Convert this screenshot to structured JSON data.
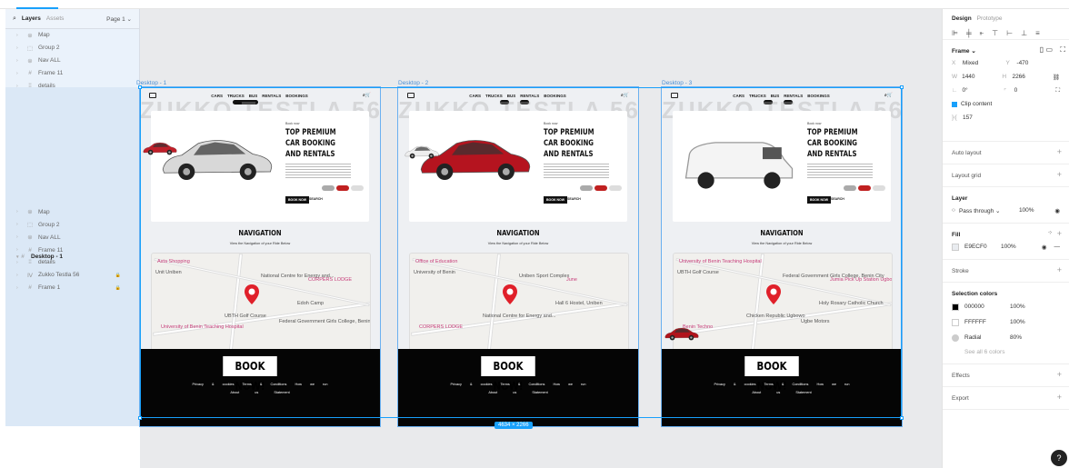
{
  "left": {
    "tabs": [
      "Layers",
      "Assets"
    ],
    "page": "Page 1",
    "groups": [
      {
        "name": "Desktop - 3",
        "children": [
          "Map",
          "Group 2",
          "Nav ALL",
          "Frame 11",
          "details",
          "Zukko Testla 56",
          "Frame 1"
        ]
      },
      {
        "name": "Desktop - 2",
        "children": [
          "Map",
          "Group 2",
          "Nav ALL",
          "Frame 11",
          "details",
          "Zukko Testla 56",
          "Frame 1"
        ]
      },
      {
        "name": "Desktop - 1",
        "children": [
          "Map",
          "Group 2",
          "Nav ALL",
          "Frame 11",
          "details",
          "Zukko Testla 56",
          "Frame 1"
        ]
      }
    ]
  },
  "canvas": {
    "frame_names": [
      "Desktop - 1",
      "Desktop - 2",
      "Desktop - 3"
    ],
    "selection_dims": "4634 × 2266",
    "nav_links": [
      "CARS",
      "TRUCKS",
      "BUS",
      "RENTALS",
      "BOOKINGS"
    ],
    "watermark": "ZUKKO TESTLA 56",
    "hero_small": "Book now",
    "hero_title": "TOP PREMIUM CAR BOOKING AND RENTALS",
    "hero_btn": "BOOK NOW",
    "hero_btn2": "SEARCH",
    "nav_title": "NAVIGATION",
    "nav_sub": "View the Navigation of your Ride Below",
    "map_labels": {
      "m1": [
        "Asta Shopping",
        "Unit Uniben",
        "National Centre for Energy and...",
        "CORPERS LODGE",
        "Edoh Camp",
        "UBTH Golf Course",
        "University of Benin Teaching Hospital",
        "Federal Government Girls College, Benin City"
      ],
      "m2": [
        "Office of Education",
        "University of Benin",
        "Uniben Sport Complex",
        "June",
        "Hall 6 Hostel, Uniben",
        "National Centre for Energy and...",
        "CORPERS LODGE"
      ],
      "m3": [
        "University of Benin Teaching Hospital",
        "UBTH Golf Course",
        "Federal Government Girls College, Benin City",
        "Jumia Pick Up Station Ugbowo",
        "Holy Rosary Catholic Church",
        "Chicken Republic Ugbowo",
        "Benin Techno",
        "Ugbe Motors"
      ]
    },
    "book": "BOOK NOW!",
    "footer_links": [
      "Privacy & cookies",
      "Terms & Conditions",
      "How we run"
    ],
    "footer_links2": [
      "About us",
      "Statement"
    ]
  },
  "right": {
    "tabs": [
      "Design",
      "Prototype"
    ],
    "frame_label": "Frame",
    "x_label": "X",
    "x": "Mixed",
    "y_label": "Y",
    "y": "-470",
    "w_label": "W",
    "w": "1440",
    "h_label": "H",
    "h": "2266",
    "rot": "0°",
    "radius": "0",
    "clip": "Clip content",
    "gap": "157",
    "auto_layout": "Auto layout",
    "layout_grid": "Layout grid",
    "layer": "Layer",
    "blend": "Pass through",
    "layer_opacity": "100%",
    "fill": "Fill",
    "fill_hex": "E9ECF0",
    "fill_pct": "100%",
    "stroke": "Stroke",
    "sel_colors": "Selection colors",
    "colors": [
      {
        "hex": "000000",
        "pct": "100%",
        "sw": "#000000"
      },
      {
        "hex": "FFFFFF",
        "pct": "100%",
        "sw": "#ffffff"
      },
      {
        "hex": "Radial",
        "pct": "80%",
        "sw": "#cccccc"
      }
    ],
    "see_all": "See all 6 colors",
    "effects": "Effects",
    "export": "Export",
    "help": "?"
  }
}
